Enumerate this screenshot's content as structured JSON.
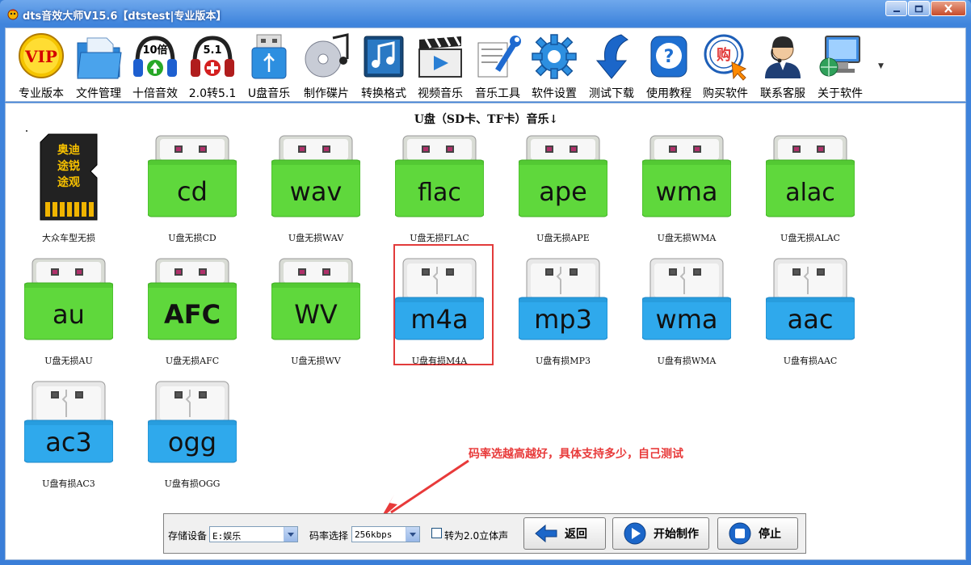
{
  "window": {
    "title": "dts音效大师V15.6【dtstest|专业版本】"
  },
  "toolbar": {
    "items": [
      {
        "label": "专业版本",
        "icon": "vip-badge-icon"
      },
      {
        "label": "文件管理",
        "icon": "folder-file-icon"
      },
      {
        "label": "十倍音效",
        "icon": "headphones-10x-icon",
        "badge": "10倍"
      },
      {
        "label": "2.0转5.1",
        "icon": "headphones-51-icon",
        "badge": "5.1"
      },
      {
        "label": "U盘音乐",
        "icon": "usb-drive-icon"
      },
      {
        "label": "制作碟片",
        "icon": "disc-music-icon"
      },
      {
        "label": "转换格式",
        "icon": "music-note-icon"
      },
      {
        "label": "视频音乐",
        "icon": "clapperboard-icon"
      },
      {
        "label": "音乐工具",
        "icon": "tools-wrench-icon"
      },
      {
        "label": "软件设置",
        "icon": "gear-icon"
      },
      {
        "label": "测试下载",
        "icon": "download-arrow-icon"
      },
      {
        "label": "使用教程",
        "icon": "help-icon"
      },
      {
        "label": "购买软件",
        "icon": "buy-cursor-icon",
        "badge": "购"
      },
      {
        "label": "联系客服",
        "icon": "support-agent-icon"
      },
      {
        "label": "关于软件",
        "icon": "computer-globe-icon"
      }
    ]
  },
  "content": {
    "section_title": "U盘（SD卡、TF卡）音乐↓",
    "annotation": "码率选越高越好，具体支持多少，自己测试",
    "sd_card_text": [
      "奥迪",
      "途锐",
      "途观"
    ],
    "items": [
      {
        "caption": "大众车型无损",
        "kind": "sdcard"
      },
      {
        "caption": "U盘无损CD",
        "kind": "green",
        "fmt": "cd"
      },
      {
        "caption": "U盘无损WAV",
        "kind": "green",
        "fmt": "wav"
      },
      {
        "caption": "U盘无损FLAC",
        "kind": "green",
        "fmt": "flac"
      },
      {
        "caption": "U盘无损APE",
        "kind": "green",
        "fmt": "ape"
      },
      {
        "caption": "U盘无损WMA",
        "kind": "green",
        "fmt": "wma"
      },
      {
        "caption": "U盘无损ALAC",
        "kind": "green",
        "fmt": "alac"
      },
      {
        "caption": "U盘无损AU",
        "kind": "green",
        "fmt": "au"
      },
      {
        "caption": "U盘无损AFC",
        "kind": "green",
        "fmt": "AFC"
      },
      {
        "caption": "U盘无损WV",
        "kind": "green",
        "fmt": "WV"
      },
      {
        "caption": "U盘有损M4A",
        "kind": "blue",
        "fmt": "m4a",
        "selected": true
      },
      {
        "caption": "U盘有损MP3",
        "kind": "blue",
        "fmt": "mp3"
      },
      {
        "caption": "U盘有损WMA",
        "kind": "blue",
        "fmt": "wma"
      },
      {
        "caption": "U盘有损AAC",
        "kind": "blue",
        "fmt": "aac"
      },
      {
        "caption": "U盘有损AC3",
        "kind": "blue",
        "fmt": "ac3"
      },
      {
        "caption": "U盘有损OGG",
        "kind": "blue",
        "fmt": "ogg"
      }
    ]
  },
  "bottom": {
    "device_label": "存储设备",
    "device_value": "E:娱乐",
    "bitrate_label": "码率选择",
    "bitrate_value": "256kbps",
    "stereo_label": "转为2.0立体声",
    "stereo_checked": false,
    "back_label": "返回",
    "start_label": "开始制作",
    "stop_label": "停止"
  },
  "colors": {
    "lossless_green": "#5fd83c",
    "lossy_blue": "#2fa9ec",
    "accent_red": "#e23b3b"
  }
}
